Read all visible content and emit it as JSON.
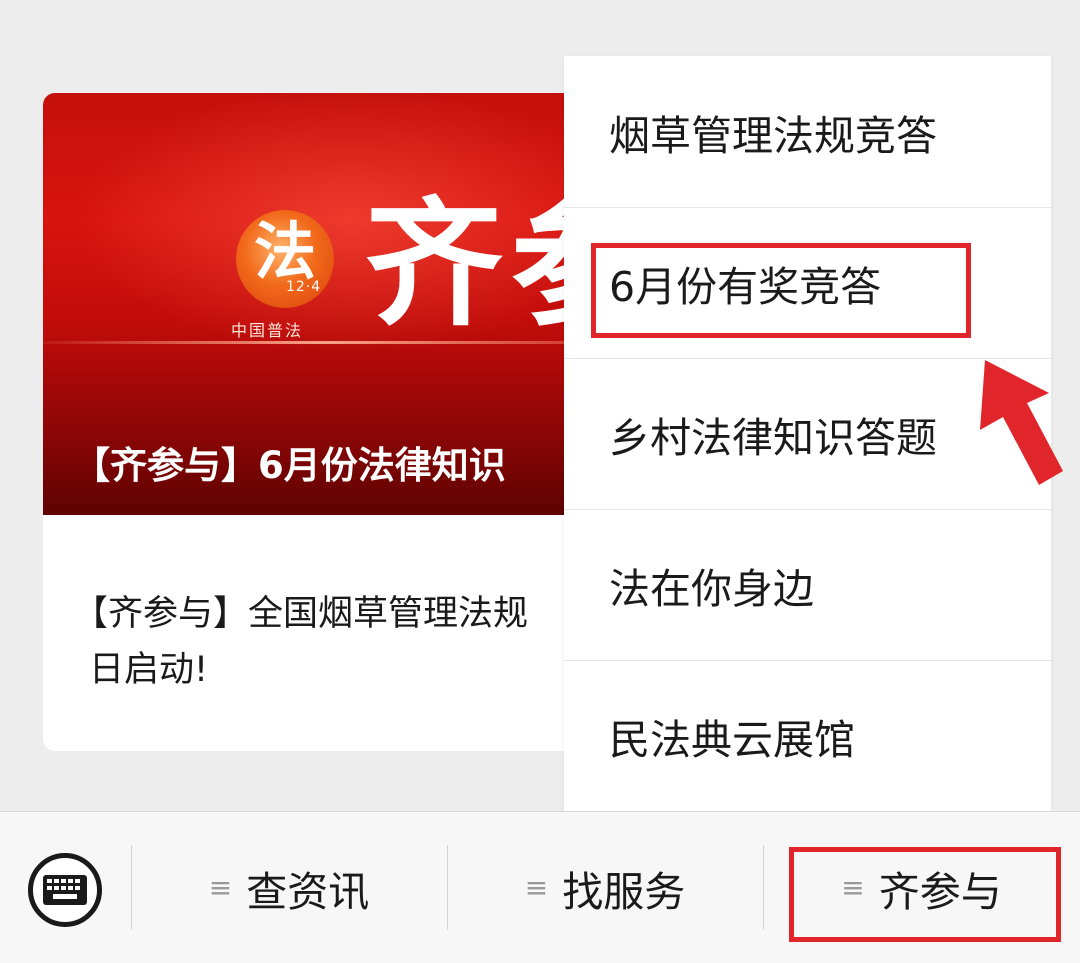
{
  "article": {
    "banner_logo_char": "法",
    "banner_logo_number": "12·4",
    "banner_logo_caption": "中国普法",
    "banner_title": "齐参",
    "banner_caption": "【齐参与】6月份法律知识",
    "description": "【齐参与】全国烟草管理法规",
    "description_line2": "日启动!"
  },
  "menu": {
    "items": [
      {
        "label": "烟草管理法规竞答"
      },
      {
        "label": "6月份有奖竞答"
      },
      {
        "label": "乡村法律知识答题"
      },
      {
        "label": "法在你身边"
      },
      {
        "label": "民法典云展馆"
      }
    ]
  },
  "bottom_bar": {
    "keyboard_icon": "keyboard-icon",
    "tabs": [
      {
        "label": "查资讯",
        "icon": "menu-lines-icon"
      },
      {
        "label": "找服务",
        "icon": "menu-lines-icon"
      },
      {
        "label": "齐参与",
        "icon": "menu-lines-icon"
      }
    ]
  },
  "annotations": {
    "highlight_color": "#e0262a"
  }
}
